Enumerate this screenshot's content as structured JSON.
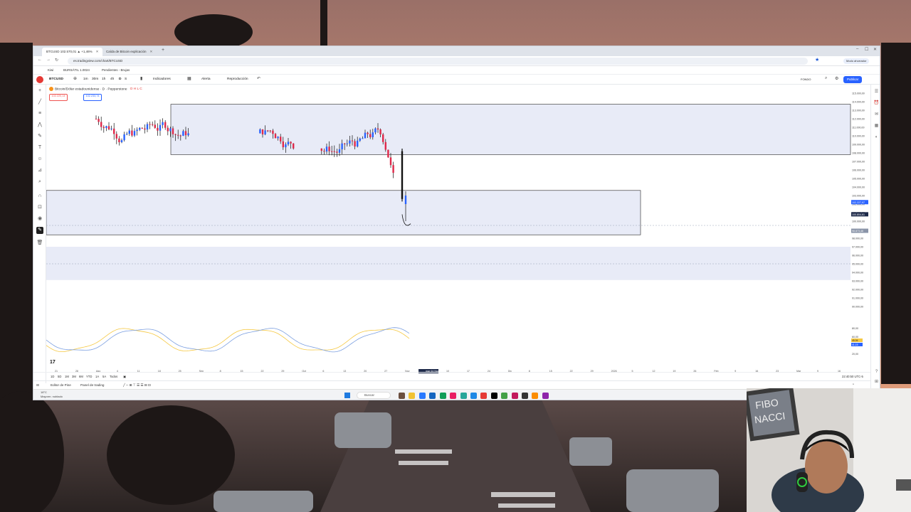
{
  "browser": {
    "tabs": [
      {
        "label": "BTCUSD 102.570,01 ▲ +1,46%",
        "active": true
      },
      {
        "label": "Caída de Bitcoin explicación",
        "active": false
      }
    ],
    "url": "es.tradingview.com/chart/BTCUSD",
    "profile": "Modo ahorrador",
    "bookmarks": [
      "Kiwi",
      "BURSÁTIL 1.0024",
      "Pendientes - Brujas"
    ]
  },
  "tradingview": {
    "symbol": "BTCUSD",
    "intervals": [
      "1m",
      "30m",
      "1h",
      "4h",
      "D",
      "S"
    ],
    "toolbar": [
      "Indicadores",
      "Alerta",
      "Reproducción"
    ],
    "layout_label": "FONDO",
    "publish_label": "Publicar",
    "legend_title": "Bitcoin/Dólar estadounidense · D · Pepperstone",
    "market_status": "O H L C",
    "sell_price": "102.220,14",
    "buy_price": "102.233,74",
    "price_scale": [
      "115.000,00",
      "114.000,00",
      "113.000,00",
      "112.000,00",
      "111.000,00",
      "110.000,00",
      "109.000,00",
      "108.000,00",
      "107.000,00",
      "106.000,00",
      "105.000,00",
      "104.000,00",
      "103.000,00",
      "102.000,00",
      "101.000,00",
      "100.000,00",
      "99.000,00",
      "98.000,00",
      "97.000,00",
      "96.000,00",
      "95.000,00",
      "94.000,00",
      "93.000,00",
      "92.000,00",
      "91.000,00",
      "90.000,00"
    ],
    "current_price_tag": "102.227,97",
    "level_tag_1": "100.804,61",
    "level_tag_2": "98.873,46",
    "osc_scale": [
      "80,00",
      "60,00",
      "40,00",
      "20,00"
    ],
    "osc_tag_1": "45,94",
    "osc_tag_2": "41,15",
    "time_axis": [
      "21",
      "28",
      "Ago",
      "4",
      "11",
      "18",
      "25",
      "Sep",
      "8",
      "15",
      "22",
      "29",
      "Oct",
      "6",
      "13",
      "20",
      "27",
      "Nov",
      "mar 04 Nov '25",
      "10",
      "17",
      "24",
      "Dic",
      "8",
      "15",
      "22",
      "29",
      "2026",
      "5",
      "12",
      "19",
      "26",
      "Feb",
      "9",
      "16",
      "23",
      "Mar",
      "9",
      "16"
    ],
    "ranges": [
      "1D",
      "5D",
      "1M",
      "3M",
      "6M",
      "YTD",
      "1A",
      "5A",
      "Todos"
    ],
    "bottom_panels": [
      "Editor de Pine",
      "Panel de trading"
    ],
    "clock": "22:40:50 UTC-5"
  },
  "taskbar": {
    "weather": "18°C",
    "weather_desc": "Mayorm. nublado",
    "search_placeholder": "Buscar"
  },
  "overlay": {
    "webcam_sign": "FIBO NACCI"
  },
  "colors": {
    "bull": "#2962ff",
    "bear": "#e0294a",
    "zone_fill": "#e8ebf7",
    "osc_blue": "#7b9fe0",
    "osc_yellow": "#f5c842"
  },
  "chart_data": {
    "type": "candlestick",
    "panes": [
      "price",
      "oscillator"
    ],
    "zones": [
      {
        "from": 107800,
        "to": 113700
      },
      {
        "from": 98400,
        "to": 103600
      },
      {
        "from": 93100,
        "to": 97000
      }
    ],
    "last_price": 102227.97
  }
}
